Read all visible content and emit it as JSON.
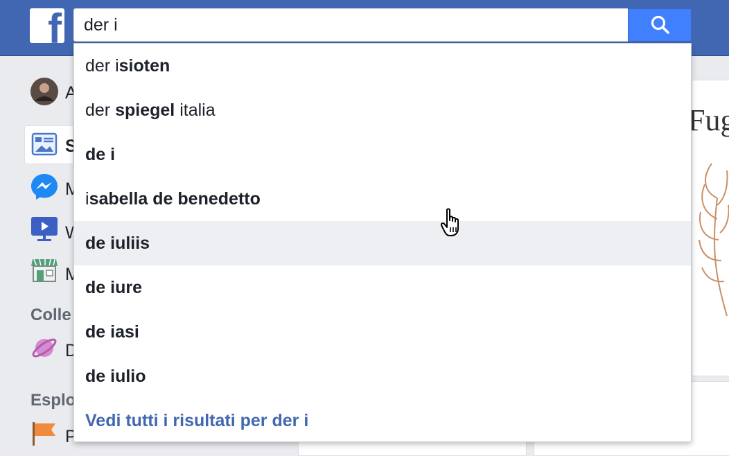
{
  "search": {
    "query": "der i"
  },
  "suggestions": [
    {
      "prefix": "der i",
      "bold": "sioten",
      "suffix": ""
    },
    {
      "prefix": "der ",
      "bold": "spiegel",
      "suffix": " italia"
    },
    {
      "prefix": "",
      "bold": "de i",
      "suffix": ""
    },
    {
      "prefix": "i",
      "bold": "sabella de benedetto",
      "suffix": ""
    },
    {
      "prefix": "",
      "bold": "de iuliis",
      "suffix": ""
    },
    {
      "prefix": "",
      "bold": "de iure",
      "suffix": ""
    },
    {
      "prefix": "",
      "bold": "de iasi",
      "suffix": ""
    },
    {
      "prefix": "",
      "bold": "de iulio",
      "suffix": ""
    }
  ],
  "see_all_label": "Vedi tutti i risultati per der i",
  "sidebar": {
    "items": [
      {
        "label": "A",
        "icon": "profile-avatar"
      },
      {
        "label": "S",
        "icon": "news-feed-icon"
      },
      {
        "label": "M",
        "icon": "messenger-icon"
      },
      {
        "label": "W",
        "icon": "watch-icon"
      },
      {
        "label": "M",
        "icon": "marketplace-icon"
      },
      {
        "label": "D",
        "icon": "dating-planet-icon"
      },
      {
        "label": "P",
        "icon": "pages-flag-icon"
      }
    ],
    "headings": [
      "Colle",
      "Esplo"
    ]
  },
  "content": {
    "title_fragment": "Fug"
  },
  "colors": {
    "topbar": "#4267b2",
    "search_button": "#4080ff",
    "link": "#4267b2",
    "hover_row": "#edeff3"
  }
}
